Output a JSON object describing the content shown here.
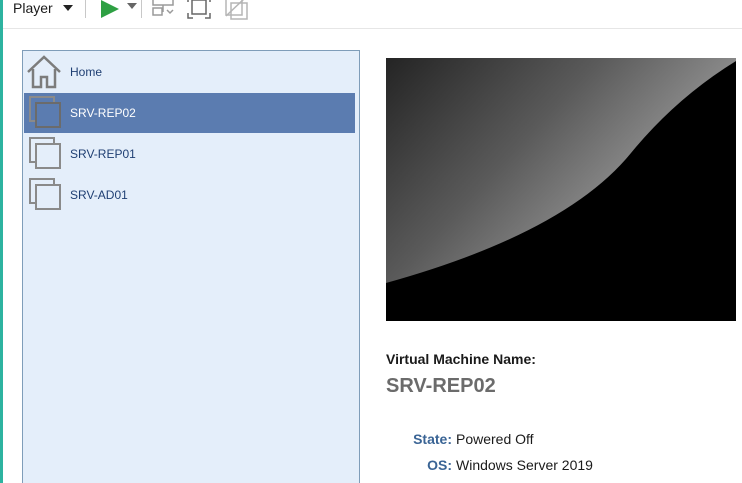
{
  "toolbar": {
    "player_label": "Player",
    "icons": [
      "play-icon",
      "send-ctrl-alt-del-icon",
      "fullscreen-icon",
      "unity-icon"
    ]
  },
  "library": {
    "items": [
      {
        "label": "Home",
        "icon": "home-icon",
        "selected": false
      },
      {
        "label": "SRV-REP02",
        "icon": "vm-icon",
        "selected": true
      },
      {
        "label": "SRV-REP01",
        "icon": "vm-icon",
        "selected": false
      },
      {
        "label": "SRV-AD01",
        "icon": "vm-icon",
        "selected": false
      }
    ]
  },
  "details": {
    "name_label": "Virtual Machine Name:",
    "name_value": "SRV-REP02",
    "properties": [
      {
        "key": "State:",
        "value": "Powered Off"
      },
      {
        "key": "OS:",
        "value": "Windows Server 2019"
      }
    ]
  },
  "colors": {
    "selection": "#5b7cb0",
    "panel_bg": "#e4eefa",
    "property_key": "#3a6495",
    "play_green": "#2ea043",
    "window_edge": "#2db3a0"
  }
}
